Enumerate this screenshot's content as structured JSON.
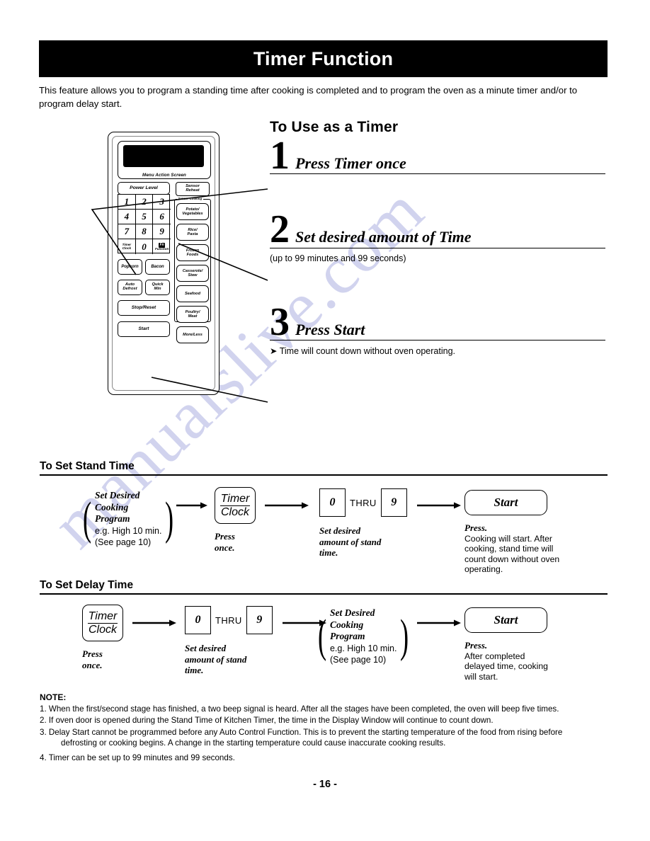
{
  "header": {
    "title": "Timer Function"
  },
  "intro": "This feature allows you to program a standing time after cooking is completed and to program the oven as a minute timer and/or to program delay start.",
  "watermark": {
    "text": "manualslive.com",
    "color": "#c9ccec"
  },
  "control_panel": {
    "screen_label": "Menu Action Screen",
    "power_level": "Power Level",
    "sensor_reheat": "Sensor/\nReheat",
    "sensor_reheat_l1": "Sensor",
    "sensor_reheat_l2": "Reheat",
    "sensor_group_label": "Sensor Cooking",
    "keypad": [
      {
        "label": "1"
      },
      {
        "label": "2"
      },
      {
        "label": "3"
      },
      {
        "label": "4"
      },
      {
        "label": "5"
      },
      {
        "label": "6"
      },
      {
        "label": "7"
      },
      {
        "label": "8"
      },
      {
        "label": "9"
      }
    ],
    "timer_clock_l1": "Timer",
    "timer_clock_l2": "Clock",
    "zero": "0",
    "function_glyph": "Fn",
    "function_label": "Function",
    "sensor_buttons": [
      {
        "l1": "Potato/",
        "l2": "Vegetables"
      },
      {
        "l1": "Rice/",
        "l2": "Pasta"
      },
      {
        "l1": "Frozen",
        "l2": "Foods"
      },
      {
        "l1": "Casserole/",
        "l2": "Stew"
      },
      {
        "l1": "Seafood",
        "l2": ""
      },
      {
        "l1": "Poultry/",
        "l2": "Meat"
      },
      {
        "l1": "More/Less",
        "l2": ""
      }
    ],
    "popcorn": "Popcorn",
    "bacon": "Bacon",
    "auto_defrost_l1": "Auto",
    "auto_defrost_l2": "Defrost",
    "quick_min_l1": "Quick",
    "quick_min_l2": "Min",
    "stop_reset": "Stop/Reset",
    "start": "Start"
  },
  "timer_section": {
    "heading": "To Use as a Timer",
    "steps": [
      {
        "num": "1",
        "text": "Press Timer once",
        "sub": ""
      },
      {
        "num": "2",
        "text": "Set desired amount of Time",
        "sub": "(up to 99 minutes and 99 seconds)"
      },
      {
        "num": "3",
        "text": "Press Start",
        "sub": "➤ Time will count down without oven operating."
      }
    ]
  },
  "stand_time": {
    "heading": "To Set Stand Time",
    "step1": {
      "brace_l1": "Set Desired",
      "brace_l2": "Cooking",
      "brace_l3": "Program",
      "brace_l4": "e.g. High 10 min.",
      "brace_l5": "(See page 10)"
    },
    "step2": {
      "key_top": "Timer",
      "key_bottom": "Clock",
      "caption_l1": "Press",
      "caption_l2": "once."
    },
    "step3": {
      "key_from": "0",
      "thru": "THRU",
      "key_to": "9",
      "caption_l1": "Set desired",
      "caption_l2": "amount of stand",
      "caption_l3": "time."
    },
    "step4": {
      "key": "Start",
      "caption_title": "Press.",
      "caption_l1": "Cooking will start. After",
      "caption_l2": "cooking, stand time will",
      "caption_l3": "count down without oven",
      "caption_l4": "operating."
    }
  },
  "delay_time": {
    "heading": "To Set Delay Time",
    "step1": {
      "key_top": "Timer",
      "key_bottom": "Clock",
      "caption_l1": "Press",
      "caption_l2": "once."
    },
    "step2": {
      "key_from": "0",
      "thru": "THRU",
      "key_to": "9",
      "caption_l1": "Set desired",
      "caption_l2": "amount of stand",
      "caption_l3": "time."
    },
    "step3": {
      "brace_l1": "Set Desired",
      "brace_l2": "Cooking",
      "brace_l3": "Program",
      "brace_l4": "e.g. High 10 min.",
      "brace_l5": "(See page 10)"
    },
    "step4": {
      "key": "Start",
      "caption_title": "Press.",
      "caption_l1": "After completed",
      "caption_l2": "delayed time, cooking",
      "caption_l3": "will start."
    }
  },
  "note": {
    "title": "NOTE:",
    "items": [
      {
        "n": "1.",
        "text": "When the first/second stage has finished, a two beep signal is heard. After all the stages have been completed, the oven will beep five times.",
        "cont": ""
      },
      {
        "n": "2.",
        "text": "If oven door is opened during the Stand Time of Kitchen Timer, the time in the Display Window will continue to count down.",
        "cont": ""
      },
      {
        "n": "3.",
        "text": "Delay Start cannot be programmed before any Auto Control Function. This is to prevent the starting temperature of the food from rising before",
        "cont": "defrosting or cooking begins. A change in the starting temperature could cause inaccurate cooking results."
      },
      {
        "n": "4.",
        "text": "Timer can be set up to 99 minutes and 99 seconds.",
        "cont": ""
      }
    ]
  },
  "page_number": "- 16 -"
}
